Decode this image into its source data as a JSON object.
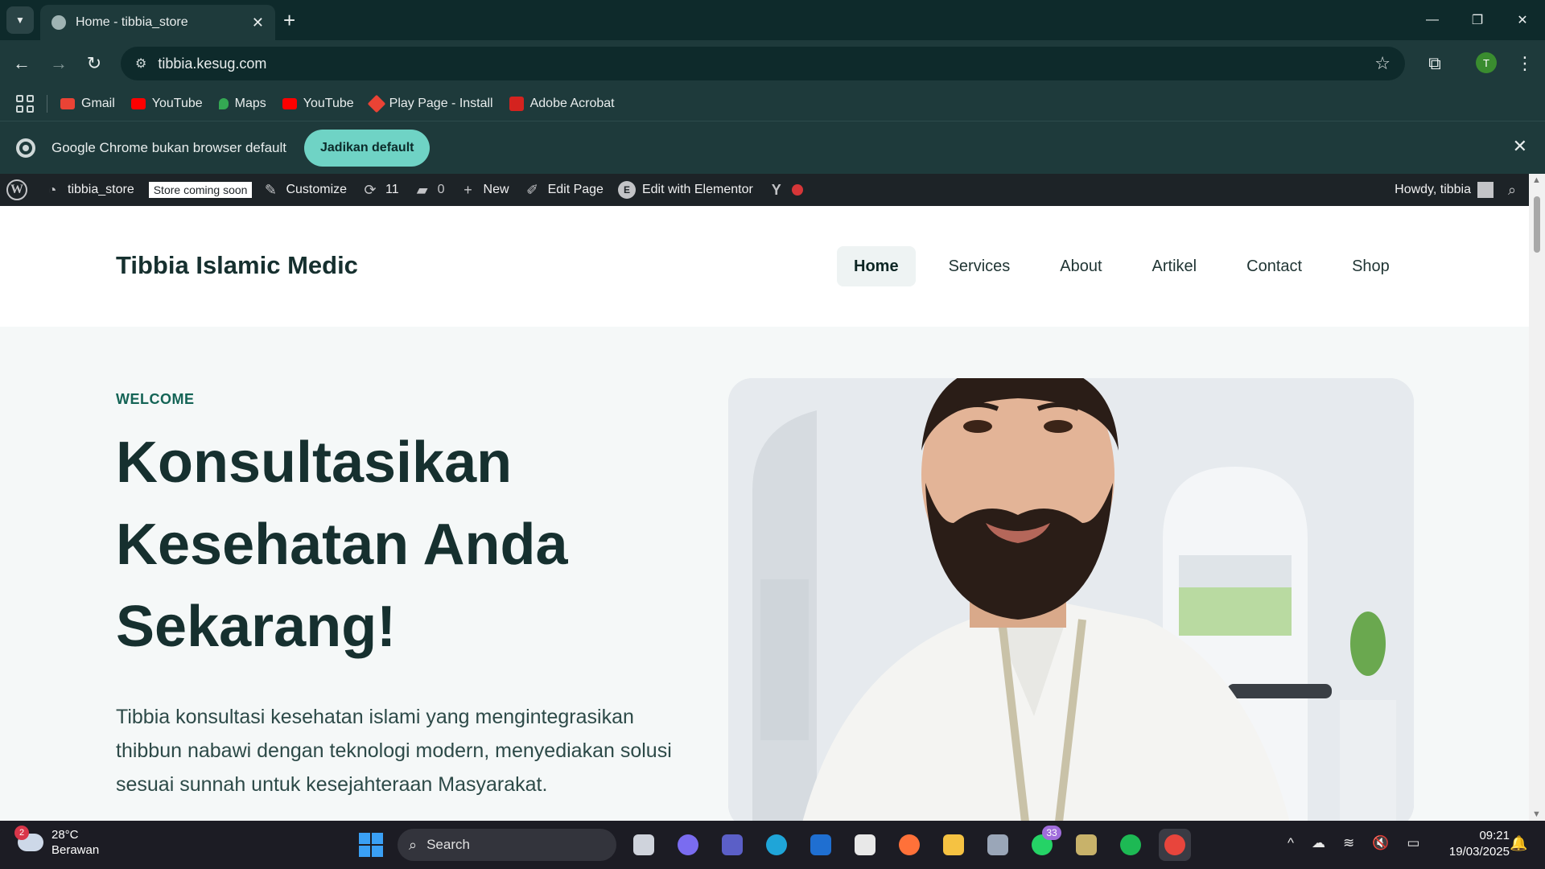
{
  "browser": {
    "tab": {
      "title": "Home - tibbia_store",
      "close": "✕"
    },
    "new_tab": "+",
    "window_controls": {
      "minimize": "—",
      "restore": "❐",
      "close": "✕"
    },
    "toolbar": {
      "back": "←",
      "forward": "→",
      "reload": "↻",
      "site_info": "⚙",
      "url": "tibbia.kesug.com",
      "star": "☆",
      "extensions": "⧉",
      "profile_initial": "T",
      "menu": "⋮"
    },
    "bookmarks": [
      {
        "label": "Gmail",
        "icon": "gmail-icon",
        "color": "#ea4335"
      },
      {
        "label": "YouTube",
        "icon": "youtube-icon",
        "color": "#ff0000"
      },
      {
        "label": "Maps",
        "icon": "maps-icon",
        "color": "#34a853"
      },
      {
        "label": "YouTube",
        "icon": "youtube-icon",
        "color": "#ff0000"
      },
      {
        "label": "Play Page - Install",
        "icon": "play-icon",
        "color": "#ea4335"
      },
      {
        "label": "Adobe Acrobat",
        "icon": "acrobat-icon",
        "color": "#d4231f"
      }
    ],
    "infobar": {
      "message": "Google Chrome bukan browser default",
      "button": "Jadikan default",
      "close": "✕"
    }
  },
  "adminbar": {
    "site_name": "tibbia_store",
    "store_badge": "Store coming soon",
    "customize": "Customize",
    "updates_count": "11",
    "comments_count": "0",
    "new": "New",
    "edit_page": "Edit Page",
    "elementor": "Edit with Elementor",
    "howdy": "Howdy, tibbia"
  },
  "site": {
    "title": "Tibbia Islamic Medic",
    "nav": [
      "Home",
      "Services",
      "About",
      "Artikel",
      "Contact",
      "Shop"
    ],
    "hero": {
      "eyebrow": "WELCOME",
      "title": "Konsultasikan Kesehatan Anda Sekarang!",
      "text": "Tibbia konsultasi kesehatan islami yang mengintegrasikan thibbun nabawi dengan teknologi modern, menyediakan solusi sesuai sunnah untuk kesejahteraan Masyarakat."
    }
  },
  "taskbar": {
    "weather": {
      "temp": "28°C",
      "condition": "Berawan",
      "badge": "2"
    },
    "search": "Search",
    "apps": [
      {
        "name": "task-view-icon",
        "color": "#cfd3dc"
      },
      {
        "name": "copilot-icon",
        "color": "#7a6cf0"
      },
      {
        "name": "teams-icon",
        "color": "#5b5fc7"
      },
      {
        "name": "edge-icon",
        "color": "#1fa5d8"
      },
      {
        "name": "defender-icon",
        "color": "#1f6fd1"
      },
      {
        "name": "store-icon",
        "color": "#e8e8e8"
      },
      {
        "name": "firefox-icon",
        "color": "#ff7139"
      },
      {
        "name": "file-explorer-icon",
        "color": "#f5c242"
      },
      {
        "name": "camera-icon",
        "color": "#9aa6b8"
      },
      {
        "name": "whatsapp-icon",
        "color": "#25d366",
        "badge": "33"
      },
      {
        "name": "app-icon",
        "color": "#c8b26a"
      },
      {
        "name": "spotify-icon",
        "color": "#1db954"
      },
      {
        "name": "chrome-icon",
        "color": "#e8453c"
      }
    ],
    "tray": {
      "chevron": "^",
      "cloud": "☁",
      "wifi": "≋",
      "volume": "🔇",
      "battery": "▭"
    },
    "time": "09:21",
    "date": "19/03/2025",
    "notifications": "🔔"
  }
}
